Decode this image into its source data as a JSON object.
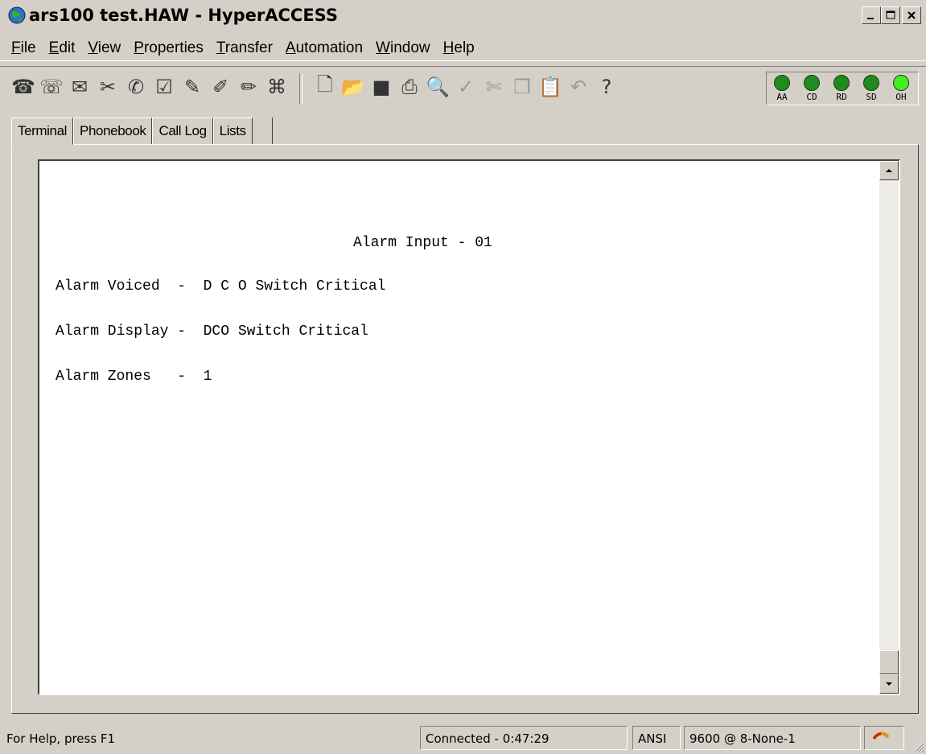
{
  "window": {
    "title": "ars100 test.HAW - HyperACCESS",
    "controls": [
      "minimize",
      "maximize",
      "close"
    ]
  },
  "menu": [
    {
      "label": "File",
      "key": "F",
      "rest": "ile"
    },
    {
      "label": "Edit",
      "key": "E",
      "rest": "dit"
    },
    {
      "label": "View",
      "key": "V",
      "rest": "iew"
    },
    {
      "label": "Properties",
      "key": "P",
      "rest": "roperties"
    },
    {
      "label": "Transfer",
      "key": "T",
      "rest": "ransfer"
    },
    {
      "label": "Automation",
      "key": "A",
      "rest": "utomation"
    },
    {
      "label": "Window",
      "key": "W",
      "rest": "indow"
    },
    {
      "label": "Help",
      "key": "H",
      "rest": "elp"
    }
  ],
  "toolbar": {
    "left_icons": [
      "dial-icon",
      "hangup-icon",
      "send-icon",
      "capture-icon",
      "receive-icon",
      "properties-icon",
      "script-icon",
      "script-edit-icon",
      "pen-icon",
      "network-icon"
    ],
    "right_icons": [
      "new-icon",
      "open-icon",
      "save-icon",
      "print-icon",
      "print-preview-icon",
      "spell-icon",
      "cut-icon",
      "copy-icon",
      "paste-icon",
      "undo-icon",
      "help-icon"
    ],
    "leds": [
      {
        "label": "AA",
        "color": "#1e8c1e"
      },
      {
        "label": "CD",
        "color": "#1e8c1e"
      },
      {
        "label": "RD",
        "color": "#1e8c1e"
      },
      {
        "label": "SD",
        "color": "#1e8c1e"
      },
      {
        "label": "OH",
        "color": "#44ee22"
      }
    ]
  },
  "tabs": [
    "Terminal",
    "Phonebook",
    "Call Log",
    "Lists"
  ],
  "terminal": {
    "title": "Alarm Input - 01",
    "voiced": "Alarm Voiced  -  D C O Switch Critical",
    "display": "Alarm Display -  DCO Switch Critical",
    "zones": "Alarm Zones   -  1"
  },
  "status": {
    "help": "For Help, press F1",
    "connection": "Connected - 0:47:29",
    "emulation": "ANSI",
    "settings": "9600 @ 8-None-1"
  }
}
